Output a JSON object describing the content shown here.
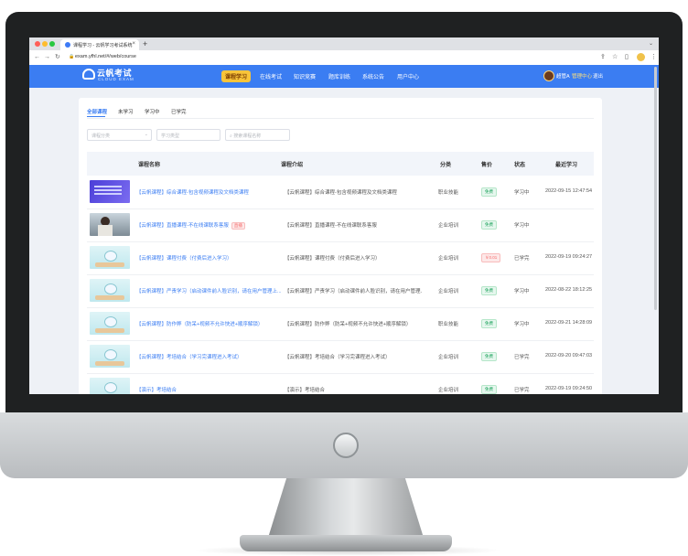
{
  "browser": {
    "tab_title": "课程学习 - 云帆学习考试系统",
    "tab_close": "×",
    "new_tab": "+",
    "menu_chevron": "⌄",
    "url": "exam.yfhl.net/#/web/course",
    "nav_icons": [
      "back-icon",
      "forward-icon",
      "reload-icon"
    ],
    "traffic_colors": [
      "#ff5f57",
      "#febc2e",
      "#28c840"
    ]
  },
  "site": {
    "logo_text": "云帆考试",
    "logo_sub": "CLOUD EXAM",
    "nav": [
      "课程学习",
      "在线考试",
      "知识竞赛",
      "题库训练",
      "系统公告",
      "用户中心"
    ],
    "active_nav": "课程学习",
    "user_name": "超管A",
    "user_center": "管理中心",
    "logout": "退出",
    "accent_color": "#3b7df2"
  },
  "filters": {
    "tabs": [
      "全部课程",
      "未学习",
      "学习中",
      "已学完"
    ],
    "active_tab": "全部课程",
    "category_placeholder": "课程分类",
    "type_placeholder": "学习类型",
    "search_placeholder": "搜索课程名称"
  },
  "table": {
    "headers": [
      "课程名称",
      "课程介绍",
      "分类",
      "售价",
      "状态",
      "最近学习"
    ],
    "rows": [
      {
        "thumb": "purple",
        "name": "【云帆课程】综合课程-包含视频课程及文档类课程",
        "badge": "",
        "intro": "【云帆课程】综合课程-包含视频课程及文档类课程",
        "category": "职业技能",
        "price": "免费",
        "price_type": "free",
        "status": "学习中",
        "recent": "2022-09-15 12:47:54"
      },
      {
        "thumb": "photo",
        "name": "【云帆课程】直播课程-不在线课联系客服",
        "badge": "直播",
        "intro": "【云帆课程】直播课程-不在线课联系客服",
        "category": "企业培训",
        "price": "免费",
        "price_type": "free",
        "status": "学习中",
        "recent": ""
      },
      {
        "thumb": "default",
        "name": "【云帆课程】课程付费（付费后进入学习）",
        "badge": "",
        "intro": "【云帆课程】课程付费（付费后进入学习）",
        "category": "企业培训",
        "price": "￥0.01",
        "price_type": "paid",
        "status": "已学完",
        "recent": "2022-09-19 09:24:27"
      },
      {
        "thumb": "default",
        "name": "【云帆课程】严责学习（启动课件前人脸识别，请在用户管理上...",
        "badge": "",
        "intro": "【云帆课程】严责学习（启动课件前人脸识别，请在用户管理上...",
        "category": "企业培训",
        "price": "免费",
        "price_type": "free",
        "status": "学习中",
        "recent": "2022-08-22 18:12:25"
      },
      {
        "thumb": "default",
        "name": "【云帆课程】防作弊（防呆+视频不允许快进+顺序解锁）",
        "badge": "",
        "intro": "【云帆课程】防作弊（防呆+视频不允许快进+顺序解锁）",
        "category": "职业技能",
        "price": "免费",
        "price_type": "free",
        "status": "学习中",
        "recent": "2022-09-21 14:28:09"
      },
      {
        "thumb": "default",
        "name": "【云帆课程】考培结合（学习完课程进入考试）",
        "badge": "",
        "intro": "【云帆课程】考培结合（学习完课程进入考试）",
        "category": "企业培训",
        "price": "免费",
        "price_type": "free",
        "status": "已学完",
        "recent": "2022-09-20 09:47:03"
      },
      {
        "thumb": "default",
        "name": "【演示】考培结合",
        "badge": "",
        "intro": "【演示】考培结合",
        "category": "企业培训",
        "price": "免费",
        "price_type": "free",
        "status": "已学完",
        "recent": "2022-09-19 09:24:50"
      }
    ]
  }
}
